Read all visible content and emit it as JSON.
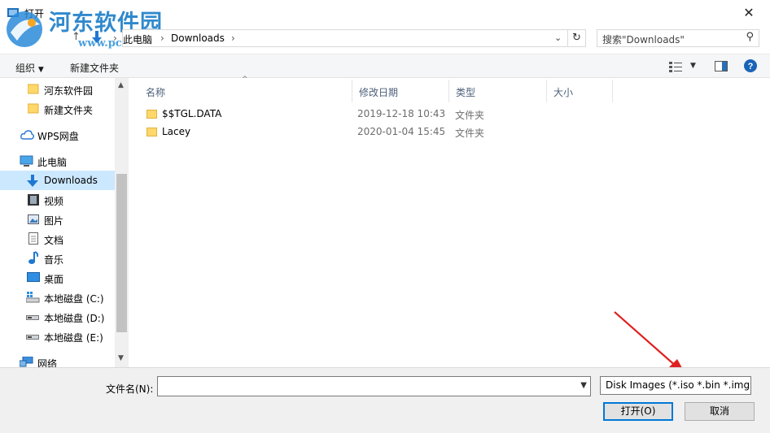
{
  "window": {
    "title": "打开",
    "close_label": "✕"
  },
  "watermark": {
    "name": "河东软件园",
    "url": "www.pc0359.cn"
  },
  "address": {
    "path": [
      "此电脑",
      "Downloads"
    ],
    "refresh_glyph": "↻"
  },
  "search": {
    "placeholder": "搜索\"Downloads\""
  },
  "toolbar": {
    "organize": "组织",
    "new_folder": "新建文件夹"
  },
  "nav": {
    "items": [
      {
        "label": "河东软件园",
        "icon": "folder-icon"
      },
      {
        "label": "新建文件夹",
        "icon": "folder-icon"
      },
      {
        "label": "WPS网盘",
        "icon": "cloud-icon"
      },
      {
        "label": "此电脑",
        "icon": "computer-icon"
      },
      {
        "label": "Downloads",
        "icon": "download-icon",
        "selected": true
      },
      {
        "label": "视频",
        "icon": "video-icon"
      },
      {
        "label": "图片",
        "icon": "pictures-icon"
      },
      {
        "label": "文档",
        "icon": "document-icon"
      },
      {
        "label": "音乐",
        "icon": "music-icon"
      },
      {
        "label": "桌面",
        "icon": "desktop-icon"
      },
      {
        "label": "本地磁盘 (C:)",
        "icon": "drive-c-icon"
      },
      {
        "label": "本地磁盘 (D:)",
        "icon": "drive-icon"
      },
      {
        "label": "本地磁盘 (E:)",
        "icon": "drive-icon"
      },
      {
        "label": "网络",
        "icon": "network-icon"
      }
    ]
  },
  "columns": [
    "名称",
    "修改日期",
    "类型",
    "大小"
  ],
  "files": [
    {
      "name": "$$TGL.DATA",
      "modified": "2019-12-18 10:43",
      "type": "文件夹",
      "size": ""
    },
    {
      "name": "Lacey",
      "modified": "2020-01-04 15:45",
      "type": "文件夹",
      "size": ""
    }
  ],
  "footer": {
    "filename_label": "文件名(N):",
    "filename_value": "",
    "filter": "Disk Images (*.iso *.bin *.img)",
    "open_button": "打开(O)",
    "cancel_button": "取消"
  },
  "colors": {
    "accent": "#0078d7",
    "selection": "#cce8ff",
    "arrow": "#e02020"
  }
}
